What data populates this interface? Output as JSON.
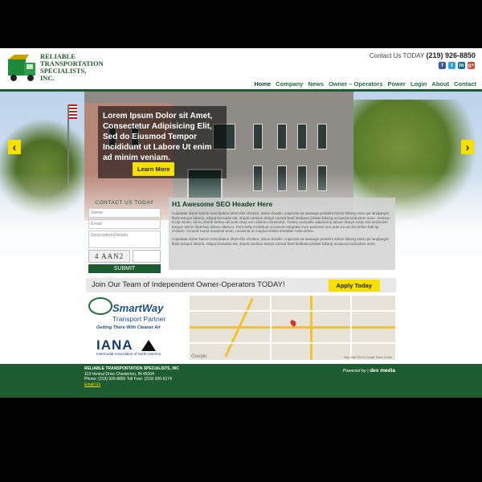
{
  "header": {
    "logo_lines": [
      "RELIABLE",
      "TRANSPORTATION",
      "SPECIALISTS,",
      "INC."
    ],
    "contact_label": "Contact Us TODAY",
    "contact_phone": "(219) 926-8850",
    "social": [
      "f",
      "t",
      "in",
      "g+"
    ]
  },
  "nav": [
    "Home",
    "Company",
    "News",
    "Owner – Operators",
    "Power",
    "Login",
    "About",
    "Contact"
  ],
  "hero": {
    "caption": "Lorem Ipsum Dolor sit Amet, Consectetur Adipisicing Elit, Sed do Eiusmod Tempor Incididunt ut Labore Ut enim ad minim veniam.",
    "button": "Learn More",
    "prev": "‹",
    "next": "›"
  },
  "contact_form": {
    "title": "CONTACT US TODAY",
    "name_placeholder": "Name:",
    "email_placeholder": "Email:",
    "desc_placeholder": "Description/Details:",
    "captcha": "4 AAN2",
    "submit": "SUBMIT"
  },
  "seo": {
    "title": "H1 Awesome SEO Header Here",
    "p1": "Cupidatat doner bacon exercitation short ribs chicken, swine boudin. Capicola ea sausage proident sirloin biltong esse qui landjaeger flank tempor laboris. Aliqua bresaola est, shank venison ribeye corned beef kielbasa brisket biltong occaecat turducken anim. Venison tri-tip minim, ad eu shank turkey tail pork chop non ullamco drumstick. Turkey andouille adipisicing labore ribeye rump sint turducken tongue sirloin leberkas dolore ullamco. Pork belly incididunt occaecat voluptate irure pastrami non aute ea ad nisi sirloin ball tip chicken. Ground round meatloaf anim, occaecat ut magna brisket shoulder nulla sirloin.",
    "p2": "Cupidatat doner bacon exercitation short ribs chicken, swine boudin. Capicola ea sausage proident sirloin biltong esse qui landjaeger flank tempor laboris. Aliqua bresaola est, shank venison ribeye corned beef kielbasa brisket biltong occaecat turducken anim."
  },
  "join": {
    "text": "Join Our Team of Independent Owner-Operators TODAY!",
    "button": "Apply Today"
  },
  "badges": {
    "smartway_name": "SmartWay",
    "smartway_sub": "Transport Partner",
    "smartway_tag": "Getting There With Cleaner Air",
    "iana_name": "IANA",
    "iana_sub": "Intermodal Association of North America"
  },
  "map": {
    "google": "Google",
    "data": "Map data ©2014 Google   Terms of Use"
  },
  "footer": {
    "name": "RELIABLE TRANSPORTATION SPECIALISTS, INC",
    "address": "119 Ventral Drive Chesterton, IN 46304",
    "phone": "Phone: (219) 926-8850 Toll Free: (219) 926-5174",
    "email": "Email Us",
    "powered": "Powered by",
    "brand": "dex media"
  },
  "colors": {
    "green": "#1d5c30",
    "yellow": "#f6e000"
  }
}
